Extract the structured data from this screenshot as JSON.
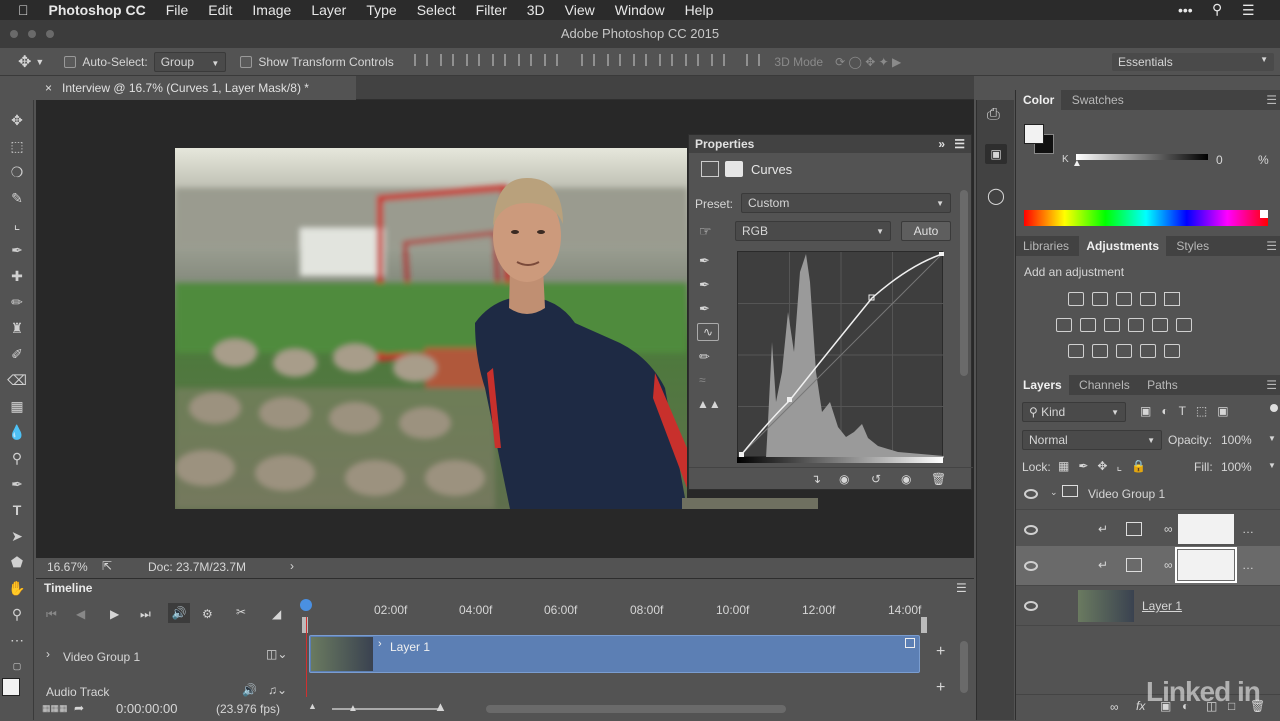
{
  "menubar": {
    "apple": "",
    "app": "Photoshop CC",
    "items": [
      "File",
      "Edit",
      "Image",
      "Layer",
      "Type",
      "Select",
      "Filter",
      "3D",
      "View",
      "Window",
      "Help"
    ]
  },
  "window": {
    "title": "Adobe Photoshop CC 2015"
  },
  "options": {
    "auto_select_label": "Auto-Select:",
    "auto_select_value": "Group",
    "show_transform_label": "Show Transform Controls",
    "mode3d": "3D Mode",
    "workspace": "Essentials"
  },
  "document": {
    "tab_title": "Interview @ 16.7% (Curves 1, Layer Mask/8) *"
  },
  "status": {
    "zoom": "16.67%",
    "doc": "Doc: 23.7M/23.7M"
  },
  "properties": {
    "title": "Properties",
    "adj_name": "Curves",
    "preset_label": "Preset:",
    "preset_value": "Custom",
    "channel": "RGB",
    "auto_label": "Auto"
  },
  "color_panel": {
    "tabs": [
      "Color",
      "Swatches"
    ],
    "k_label": "K",
    "k_value": "0",
    "pct": "%"
  },
  "adjustments": {
    "tabs": [
      "Libraries",
      "Adjustments",
      "Styles"
    ],
    "add_label": "Add an adjustment"
  },
  "layers": {
    "tabs": [
      "Layers",
      "Channels",
      "Paths"
    ],
    "kind": "Kind",
    "blend": "Normal",
    "opacity_label": "Opacity:",
    "opacity": "100%",
    "lock_label": "Lock:",
    "fill_label": "Fill:",
    "fill": "100%",
    "rows": [
      {
        "name": "Video Group 1"
      },
      {
        "name": ""
      },
      {
        "name": ""
      },
      {
        "name": "Layer 1"
      }
    ]
  },
  "timeline": {
    "title": "Timeline",
    "ticks": [
      "02:00f",
      "04:00f",
      "06:00f",
      "08:00f",
      "10:00f",
      "12:00f",
      "14:00f"
    ],
    "group": "Video Group 1",
    "clip": "Layer 1",
    "audio": "Audio Track",
    "timecode": "0:00:00:00",
    "fps": "(23.976 fps)"
  },
  "watermark": "Linked in",
  "colors": {
    "accent": "#6b8cc0",
    "panel": "#535353",
    "dark": "#282828"
  }
}
